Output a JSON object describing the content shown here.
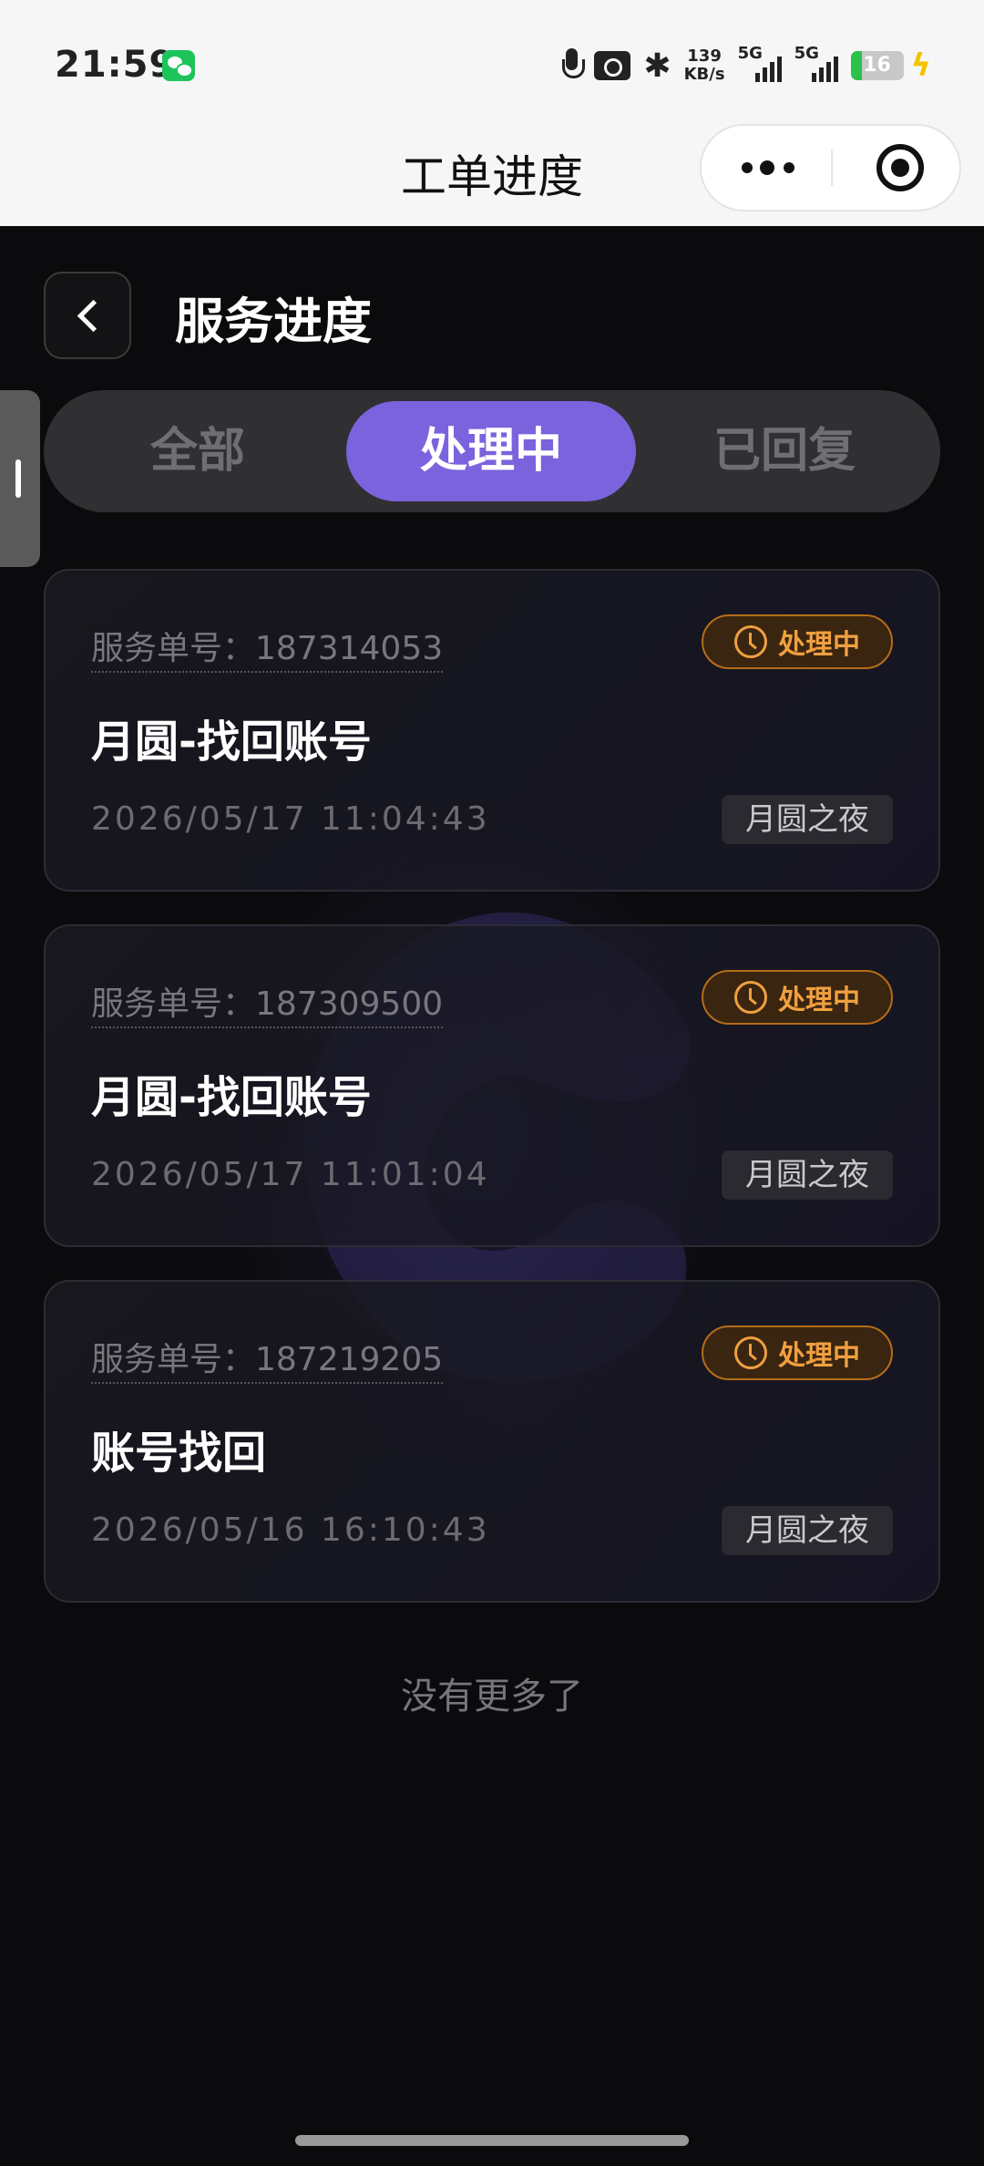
{
  "status_bar": {
    "time": "21:59",
    "net_speed_value": "139",
    "net_speed_unit": "KB/s",
    "signal1_label": "5G",
    "signal2_label": "5G",
    "battery_level": "16",
    "icons": [
      "wechat-icon",
      "mic-icon",
      "camera-icon",
      "bluetooth-icon",
      "signal-icon",
      "battery-icon",
      "charging-icon"
    ]
  },
  "mini_program": {
    "title": "工单进度",
    "more_icon": "more-dots-icon",
    "close_icon": "target-close-icon"
  },
  "page": {
    "title": "服务进度",
    "back_icon": "chevron-left-icon"
  },
  "tabs": [
    {
      "label": "全部",
      "active": false
    },
    {
      "label": "处理中",
      "active": true
    },
    {
      "label": "已回复",
      "active": false
    }
  ],
  "tickets": [
    {
      "order_label": "服务单号：187314053",
      "status": "处理中",
      "title": "月圆-找回账号",
      "time": "2026/05/17 11:04:43",
      "game": "月圆之夜"
    },
    {
      "order_label": "服务单号：187309500",
      "status": "处理中",
      "title": "月圆-找回账号",
      "time": "2026/05/17 11:01:04",
      "game": "月圆之夜"
    },
    {
      "order_label": "服务单号：187219205",
      "status": "处理中",
      "title": "账号找回",
      "time": "2026/05/16 16:10:43",
      "game": "月圆之夜"
    }
  ],
  "footer": {
    "no_more": "没有更多了"
  },
  "colors": {
    "accent": "#7b63dd",
    "status_orange": "#f0a040",
    "background": "#0b0b0d"
  }
}
